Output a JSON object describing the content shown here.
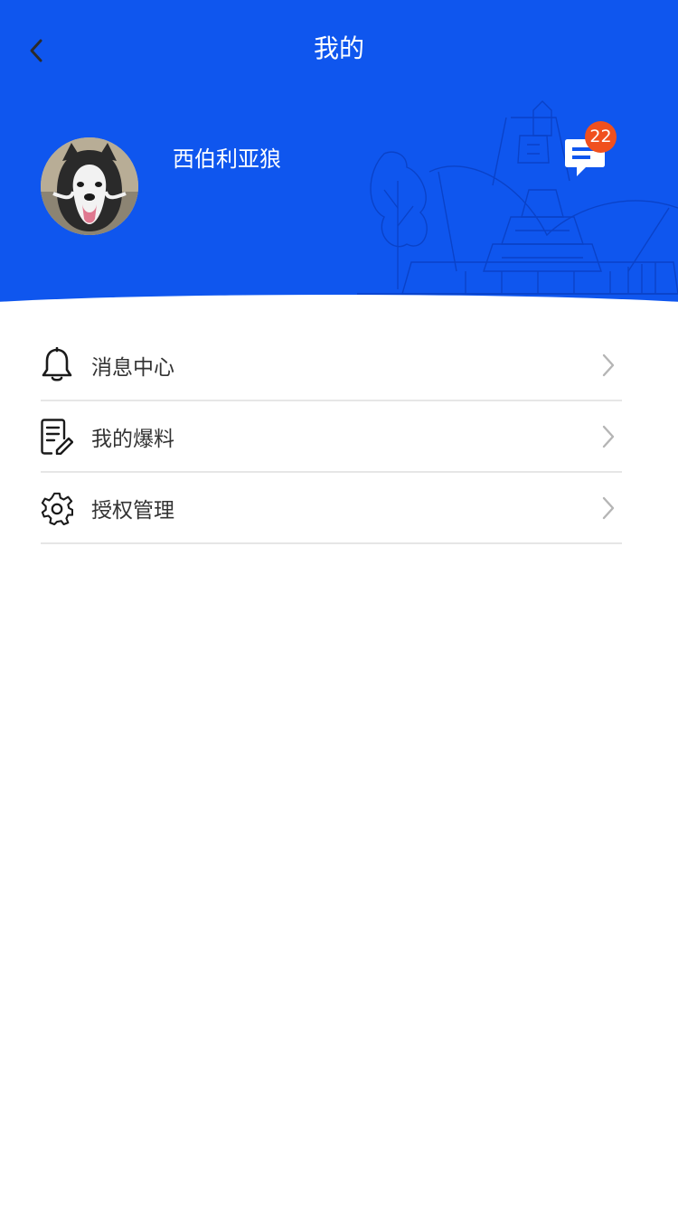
{
  "header": {
    "title": "我的",
    "back_icon": "chevron-left-icon",
    "background_color": "#0f56ee"
  },
  "profile": {
    "avatar_icon": "husky-avatar",
    "username": "西伯利亚狼"
  },
  "messages": {
    "icon": "chat-bubble-icon",
    "badge_count": "22",
    "badge_color": "#f0501e"
  },
  "menu": {
    "items": [
      {
        "label": "消息中心",
        "icon": "bell-icon"
      },
      {
        "label": "我的爆料",
        "icon": "document-edit-icon"
      },
      {
        "label": "授权管理",
        "icon": "gear-icon"
      }
    ],
    "arrow_icon": "chevron-right-icon"
  }
}
